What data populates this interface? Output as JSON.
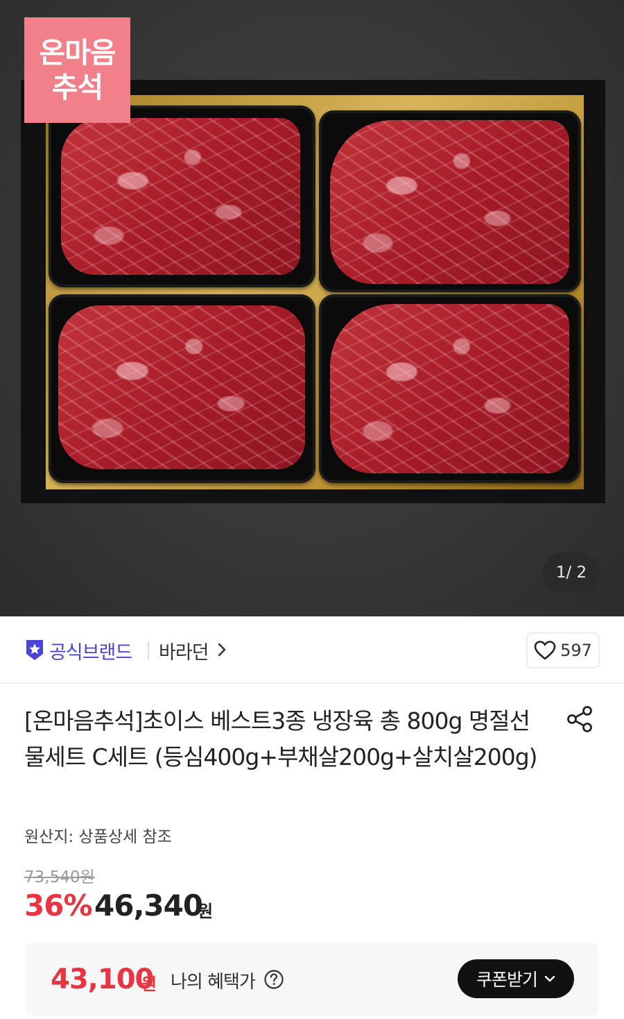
{
  "hero": {
    "badge_line1": "온마음",
    "badge_line2": "추석",
    "counter": "1/ 2"
  },
  "brand": {
    "official_label": "공식브랜드",
    "name": "바라던",
    "like_count": "597",
    "accent_color": "#4a45d6"
  },
  "product": {
    "title": "[온마음추석]초이스 베스트3종 냉장육 총 800g 명절선물세트 C세트 (등심400g+부채살200g+살치살200g)",
    "origin": "원산지: 상품상세 참조"
  },
  "price": {
    "original": "73,540원",
    "discount_rate": "36%",
    "sale": "46,340",
    "sale_unit": "원",
    "discount_color": "#ea3443"
  },
  "benefit": {
    "price": "43,100",
    "unit": "원",
    "label": "나의 혜택가",
    "coupon_button": "쿠폰받기"
  }
}
